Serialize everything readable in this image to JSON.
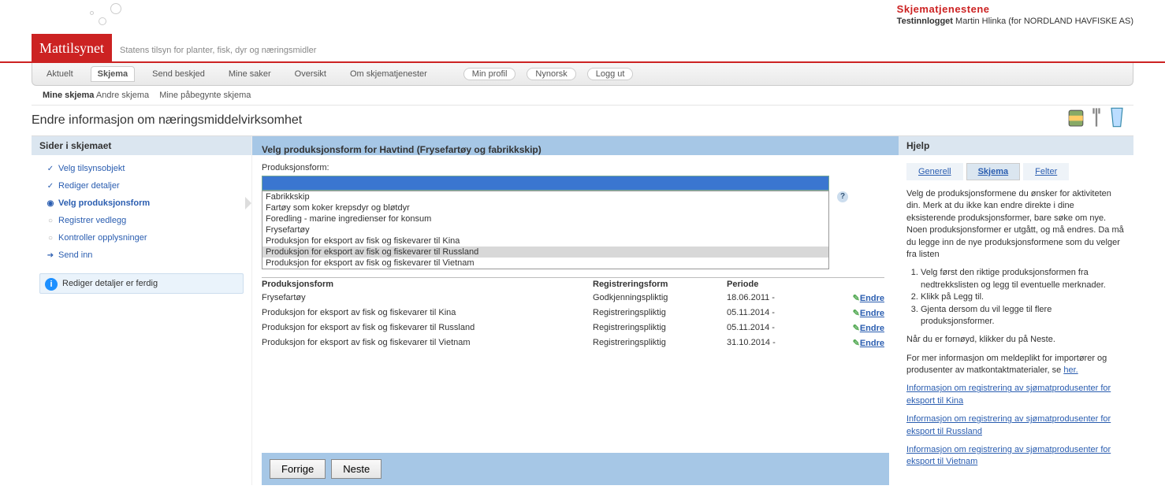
{
  "portal": {
    "title": "Skjematjenestene",
    "login_prefix": "Testinnlogget",
    "login_user": "Martin Hlinka (for NORDLAND HAVFISKE AS)"
  },
  "brand": {
    "name": "Mattilsynet",
    "tagline": "Statens tilsyn for planter, fisk, dyr og næringsmidler"
  },
  "menu": {
    "tabs": [
      "Aktuelt",
      "Skjema",
      "Send beskjed",
      "Mine saker",
      "Oversikt",
      "Om skjematjenester"
    ],
    "active_index": 1,
    "pills": [
      "Min profil",
      "Nynorsk",
      "Logg ut"
    ]
  },
  "submenu": {
    "items": [
      "Mine skjema",
      "Andre skjema",
      "Mine påbegynte skjema"
    ],
    "active_index": 0
  },
  "page_title": "Endre informasjon om næringsmiddelvirksomhet",
  "sidebar": {
    "heading": "Sider i skjemaet",
    "items": [
      {
        "label": "Velg tilsynsobjekt",
        "icon": "check"
      },
      {
        "label": "Rediger detaljer",
        "icon": "check"
      },
      {
        "label": "Velg produksjonsform",
        "icon": "dot",
        "active": true
      },
      {
        "label": "Registrer vedlegg",
        "icon": "circle"
      },
      {
        "label": "Kontroller opplysninger",
        "icon": "circle"
      },
      {
        "label": "Send inn",
        "icon": "arrow"
      }
    ],
    "notice": "Rediger detaljer er ferdig"
  },
  "main": {
    "heading": "Velg produksjonsform for Havtind (Frysefartøy og fabrikkskip)",
    "field_label": "Produksjonsform:",
    "dropdown": [
      "Fabrikkskip",
      "Fartøy som koker krepsdyr og bløtdyr",
      "Foredling - marine ingredienser for konsum",
      "Frysefartøy",
      "Produksjon for eksport av fisk og fiskevarer til Kina",
      "Produksjon for eksport av fisk og fiskevarer til Russland",
      "Produksjon for eksport av fisk og fiskevarer til Vietnam"
    ],
    "highlight_index": 5,
    "table": {
      "headers": [
        "Produksjonsform",
        "Registreringsform",
        "Periode",
        ""
      ],
      "rows": [
        {
          "pf": "Frysefartøy",
          "reg": "Godkjenningspliktig",
          "per": "18.06.2011 -",
          "action": "Endre"
        },
        {
          "pf": "Produksjon for eksport av fisk og fiskevarer til Kina",
          "reg": "Registreringspliktig",
          "per": "05.11.2014 -",
          "action": "Endre"
        },
        {
          "pf": "Produksjon for eksport av fisk og fiskevarer til Russland",
          "reg": "Registreringspliktig",
          "per": "05.11.2014 -",
          "action": "Endre"
        },
        {
          "pf": "Produksjon for eksport av fisk og fiskevarer til Vietnam",
          "reg": "Registreringspliktig",
          "per": "31.10.2014 -",
          "action": "Endre"
        }
      ]
    },
    "btn_prev": "Forrige",
    "btn_next": "Neste"
  },
  "help": {
    "heading": "Hjelp",
    "tabs": [
      "Generell",
      "Skjema",
      "Felter"
    ],
    "active_index": 1,
    "intro": "Velg de produksjonsformene du ønsker for aktiviteten din. Merk at du ikke kan endre direkte i dine eksisterende produksjonsformer, bare søke om nye. Noen produksjonsformer er utgått, og må endres. Da må du legge inn de nye produksjonsformene som du velger fra listen",
    "ol": [
      "Velg først den riktige produksjonsformen fra nedtrekkslisten og legg til eventuelle merknader.",
      "Klikk på Legg til.",
      "Gjenta dersom du vil legge til flere produksjonsformer."
    ],
    "after_ol": "Når du er fornøyd, klikker du på Neste.",
    "more_pre": "For mer informasjon om meldeplikt for importører og produsenter av matkontaktmaterialer, se ",
    "more_link": "her.",
    "links": [
      "Informasjon om registrering av sjømatprodusenter for eksport til Kina",
      "Informasjon om registrering av sjømatprodusenter for eksport til Russland",
      "Informasjon om registrering av sjømatprodusenter for eksport til Vietnam"
    ]
  }
}
